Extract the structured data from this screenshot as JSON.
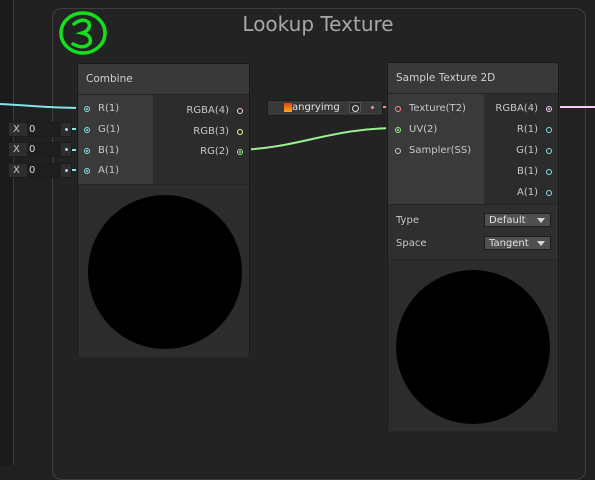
{
  "group": {
    "title": "Lookup Texture",
    "badge_number": "3"
  },
  "combine": {
    "title": "Combine",
    "inputs": [
      {
        "label": "R(1)"
      },
      {
        "label": "G(1)"
      },
      {
        "label": "B(1)"
      },
      {
        "label": "A(1)"
      }
    ],
    "outputs": [
      {
        "label": "RGBA(4)"
      },
      {
        "label": "RGB(3)"
      },
      {
        "label": "RG(2)"
      }
    ],
    "default_fields": [
      {
        "axis": "X",
        "value": "0"
      },
      {
        "axis": "X",
        "value": "0"
      },
      {
        "axis": "X",
        "value": "0"
      }
    ]
  },
  "texture_asset": {
    "name": "angryimg"
  },
  "sample": {
    "title": "Sample Texture 2D",
    "inputs": [
      {
        "label": "Texture(T2)"
      },
      {
        "label": "UV(2)"
      },
      {
        "label": "Sampler(SS)"
      }
    ],
    "outputs": [
      {
        "label": "RGBA(4)"
      },
      {
        "label": "R(1)"
      },
      {
        "label": "G(1)"
      },
      {
        "label": "B(1)"
      },
      {
        "label": "A(1)"
      }
    ],
    "properties": {
      "type_label": "Type",
      "type_value": "Default",
      "space_label": "Space",
      "space_value": "Tangent"
    }
  },
  "colors": {
    "float": "#84e4e7",
    "vector2": "#9aef92",
    "vector3": "#f6ff9a",
    "vector4": "#fbcbf4",
    "texture": "#ff8b8b",
    "sampler": "#c8c8c8",
    "group_badge": "#14e01e"
  }
}
